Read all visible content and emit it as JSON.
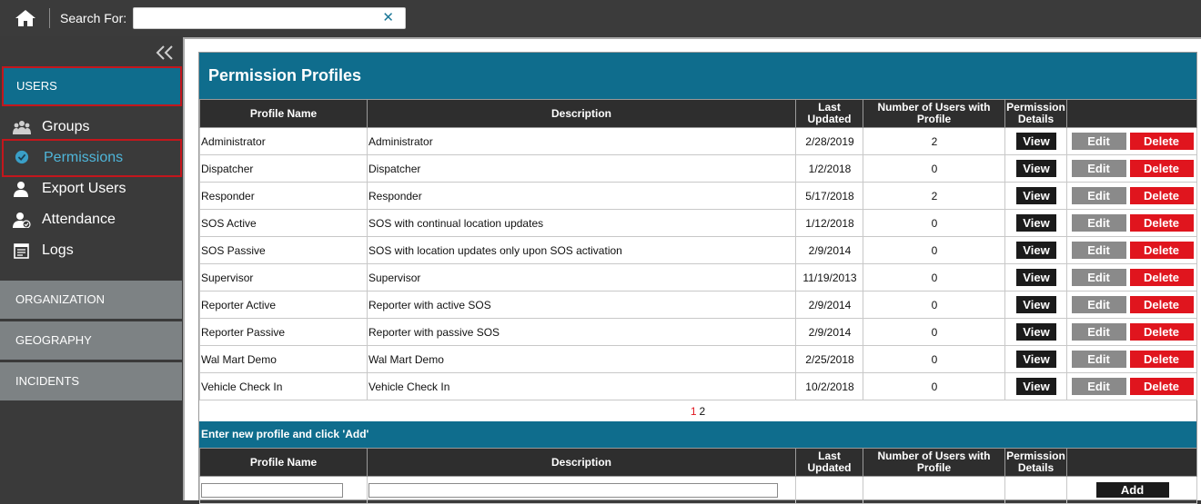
{
  "topbar": {
    "search_label": "Search For:",
    "search_value": "",
    "clear_symbol": "✕"
  },
  "sidebar": {
    "active_section": "USERS",
    "items": [
      {
        "label": "Groups",
        "icon": "groups-icon"
      },
      {
        "label": "Permissions",
        "icon": "check-circle-icon"
      },
      {
        "label": "Export Users",
        "icon": "user-export-icon"
      },
      {
        "label": "Attendance",
        "icon": "user-check-icon"
      },
      {
        "label": "Logs",
        "icon": "calendar-log-icon"
      }
    ],
    "sections": [
      "ORGANIZATION",
      "GEOGRAPHY",
      "INCIDENTS"
    ]
  },
  "panel": {
    "title": "Permission Profiles",
    "columns": {
      "profile_name": "Profile Name",
      "description": "Description",
      "last_updated": "Last Updated",
      "num_users": "Number of Users with Profile",
      "permission_details": "Permission Details"
    },
    "rows": [
      {
        "name": "Administrator",
        "description": "Administrator",
        "updated": "2/28/2019",
        "users": "2"
      },
      {
        "name": "Dispatcher",
        "description": "Dispatcher",
        "updated": "1/2/2018",
        "users": "0"
      },
      {
        "name": "Responder",
        "description": "Responder",
        "updated": "5/17/2018",
        "users": "2"
      },
      {
        "name": "SOS Active",
        "description": "SOS with continual location updates",
        "updated": "1/12/2018",
        "users": "0"
      },
      {
        "name": "SOS Passive",
        "description": "SOS with location updates only upon SOS activation",
        "updated": "2/9/2014",
        "users": "0"
      },
      {
        "name": "Supervisor",
        "description": "Supervisor",
        "updated": "11/19/2013",
        "users": "0"
      },
      {
        "name": "Reporter Active",
        "description": "Reporter with active SOS",
        "updated": "2/9/2014",
        "users": "0"
      },
      {
        "name": "Reporter Passive",
        "description": "Reporter with passive SOS",
        "updated": "2/9/2014",
        "users": "0"
      },
      {
        "name": "Wal Mart Demo",
        "description": "Wal Mart Demo",
        "updated": "2/25/2018",
        "users": "0"
      },
      {
        "name": "Vehicle Check In",
        "description": "Vehicle Check In",
        "updated": "10/2/2018",
        "users": "0"
      }
    ],
    "buttons": {
      "view": "View",
      "edit": "Edit",
      "delete": "Delete"
    },
    "pager": {
      "current": "1",
      "next": "2"
    },
    "new_profile": {
      "prompt": "Enter new profile and click 'Add'",
      "add_label": "Add",
      "name_value": "",
      "description_value": ""
    }
  },
  "colors": {
    "accent": "#0f6d8d",
    "highlight": "#c4161c",
    "delete": "#e0151e"
  }
}
